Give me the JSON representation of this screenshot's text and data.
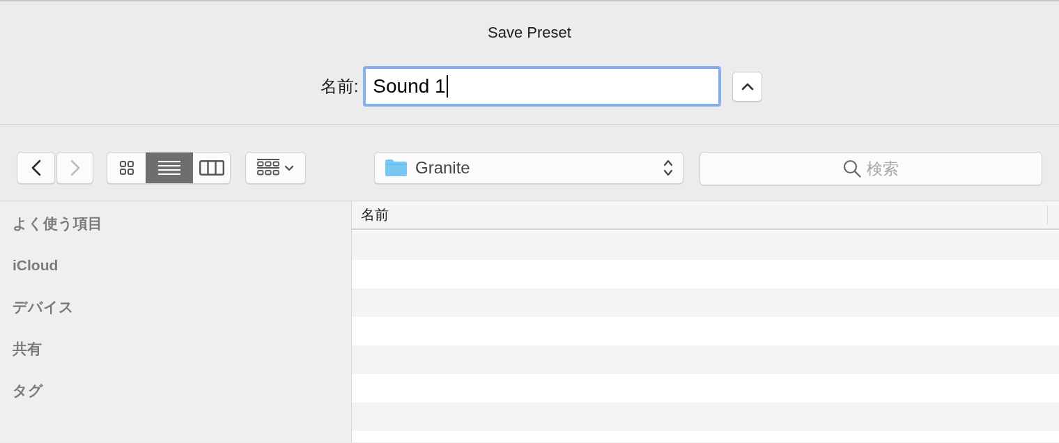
{
  "window": {
    "title": "Save Preset"
  },
  "name_field": {
    "label": "名前:",
    "value": "Sound 1",
    "focused": true
  },
  "disclosure_button": {
    "expanded": true
  },
  "toolbar": {
    "back": {
      "disabled": false
    },
    "forward": {
      "disabled": true
    },
    "view_modes": [
      {
        "kind": "icons",
        "selected": false
      },
      {
        "kind": "list",
        "selected": true
      },
      {
        "kind": "columns",
        "selected": false
      }
    ],
    "location": {
      "folder": "Granite"
    },
    "search": {
      "placeholder": "検索"
    }
  },
  "sidebar": {
    "sections": [
      {
        "label": "よく使う項目"
      },
      {
        "label": "iCloud"
      },
      {
        "label": "デバイス"
      },
      {
        "label": "共有"
      },
      {
        "label": "タグ"
      }
    ]
  },
  "file_list": {
    "columns": [
      {
        "label": "名前"
      }
    ]
  }
}
